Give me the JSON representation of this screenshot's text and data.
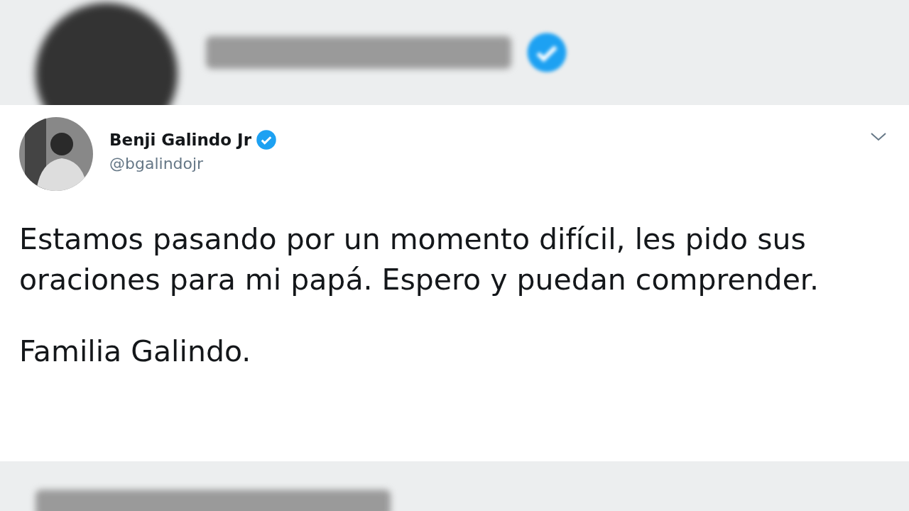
{
  "tweet": {
    "author": {
      "name": "Benji Galindo Jr",
      "handle": "@bgalindojr",
      "verified": true
    },
    "paragraphs": [
      "Estamos pasando por un momento difícil, les pido sus oraciones para mi papá. Espero y puedan comprender.",
      "Familia Galindo."
    ]
  }
}
